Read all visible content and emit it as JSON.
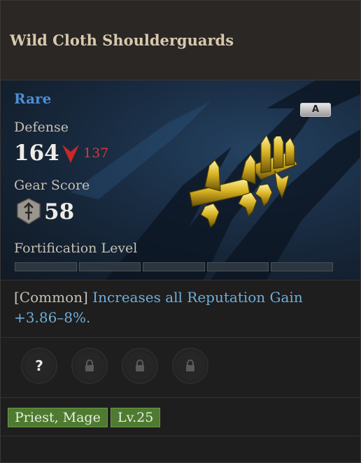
{
  "item": {
    "name": "Wild Cloth Shoulderguards",
    "rarity": "Rare",
    "grade": "A",
    "rarity_color": "#4b8ed6"
  },
  "defense": {
    "label": "Defense",
    "value": "164",
    "compare_value": "137",
    "compare_icon": "down-arrow-icon"
  },
  "gear_score": {
    "label": "Gear Score",
    "value": "58",
    "icon": "sword-shield-icon"
  },
  "fortification": {
    "label": "Fortification Level",
    "filled": 0,
    "total": 5
  },
  "trait": {
    "tier": "[Common]",
    "description": "Increases all Reputation Gain +3.86–8%."
  },
  "sockets": [
    {
      "state": "unknown",
      "icon": "question-icon"
    },
    {
      "state": "locked",
      "icon": "lock-icon"
    },
    {
      "state": "locked",
      "icon": "lock-icon"
    },
    {
      "state": "locked",
      "icon": "lock-icon"
    }
  ],
  "tags": {
    "classes": "Priest, Mage",
    "level": "Lv.25"
  }
}
